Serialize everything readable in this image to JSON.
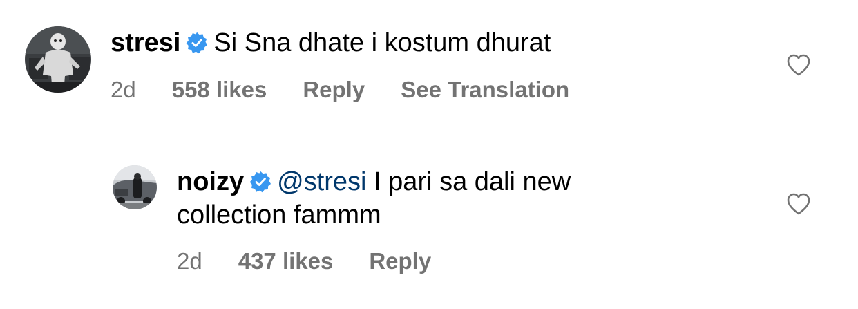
{
  "comments": [
    {
      "username": "stresi",
      "verified": true,
      "text": "Si Sna dhate i kostum dhurat",
      "time": "2d",
      "likes": "558 likes",
      "reply_label": "Reply",
      "translation_label": "See Translation",
      "avatar_icon": "avatar-masked-person-icon",
      "like_icon": "heart-outline-icon"
    }
  ],
  "replies": [
    {
      "username": "noizy",
      "verified": true,
      "mention": "@stresi",
      "text": "I pari sa dali new collection fammm",
      "time": "2d",
      "likes": "437 likes",
      "reply_label": "Reply",
      "avatar_icon": "avatar-person-car-icon",
      "like_icon": "heart-outline-icon"
    }
  ],
  "colors": {
    "verified_badge": "#3897f0",
    "mention": "#00376b",
    "meta_text": "#737373",
    "heart_stroke": "#737373"
  }
}
